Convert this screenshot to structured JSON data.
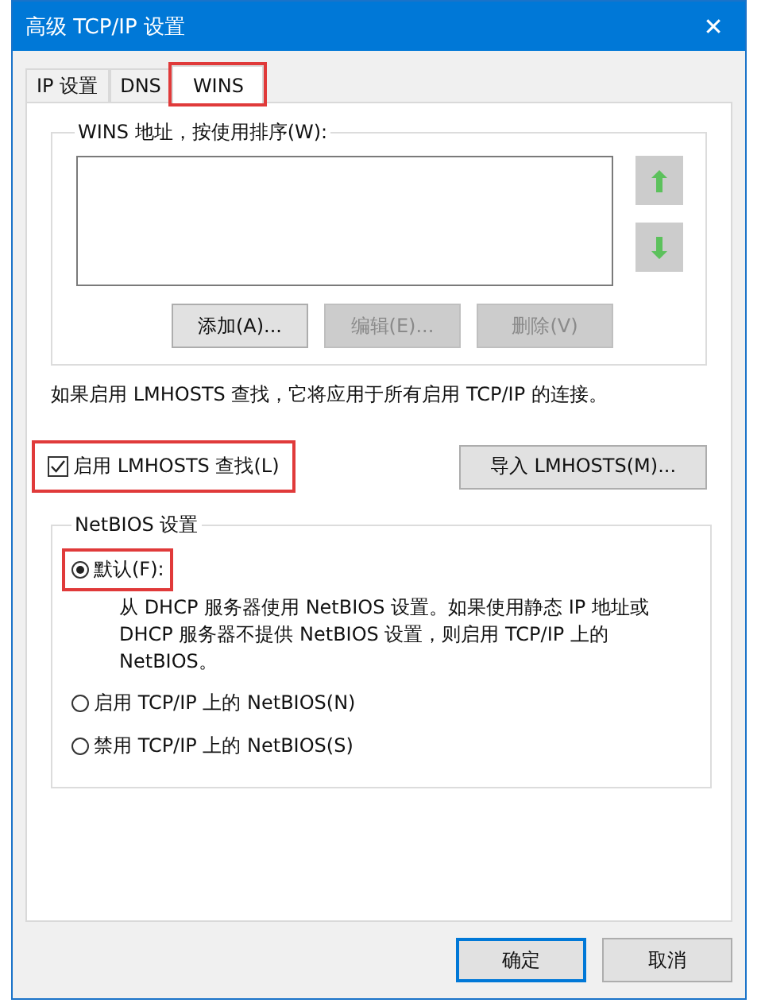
{
  "window": {
    "title": "高级 TCP/IP 设置",
    "close": "✕"
  },
  "tabs": [
    {
      "label": "IP 设置",
      "selected": false,
      "highlighted": false
    },
    {
      "label": "DNS",
      "selected": false,
      "highlighted": false
    },
    {
      "label": "WINS",
      "selected": true,
      "highlighted": true
    }
  ],
  "wins_group": {
    "title": "WINS 地址，按使用排序(W):",
    "buttons": [
      {
        "label": "添加(A)...",
        "disabled": false
      },
      {
        "label": "编辑(E)...",
        "disabled": true
      },
      {
        "label": "删除(V)",
        "disabled": true
      }
    ]
  },
  "note": "如果启用 LMHOSTS 查找，它将应用于所有启用 TCP/IP 的连接。",
  "lmhosts": {
    "label": "启用 LMHOSTS 查找(L)",
    "checked": true,
    "highlighted": true
  },
  "import_button": "导入 LMHOSTS(M)...",
  "netbios": {
    "title": "NetBIOS 设置",
    "options": [
      {
        "label": "默认(F):",
        "selected": true,
        "highlighted": true,
        "description": "从 DHCP 服务器使用 NetBIOS 设置。如果使用静态 IP 地址或 DHCP 服务器不提供 NetBIOS 设置，则启用 TCP/IP 上的 NetBIOS。"
      },
      {
        "label": "启用 TCP/IP 上的 NetBIOS(N)",
        "selected": false,
        "highlighted": false
      },
      {
        "label": "禁用 TCP/IP 上的 NetBIOS(S)",
        "selected": false,
        "highlighted": false
      }
    ]
  },
  "footer_buttons": [
    {
      "label": "确定",
      "default": true
    },
    {
      "label": "取消",
      "default": false
    }
  ]
}
